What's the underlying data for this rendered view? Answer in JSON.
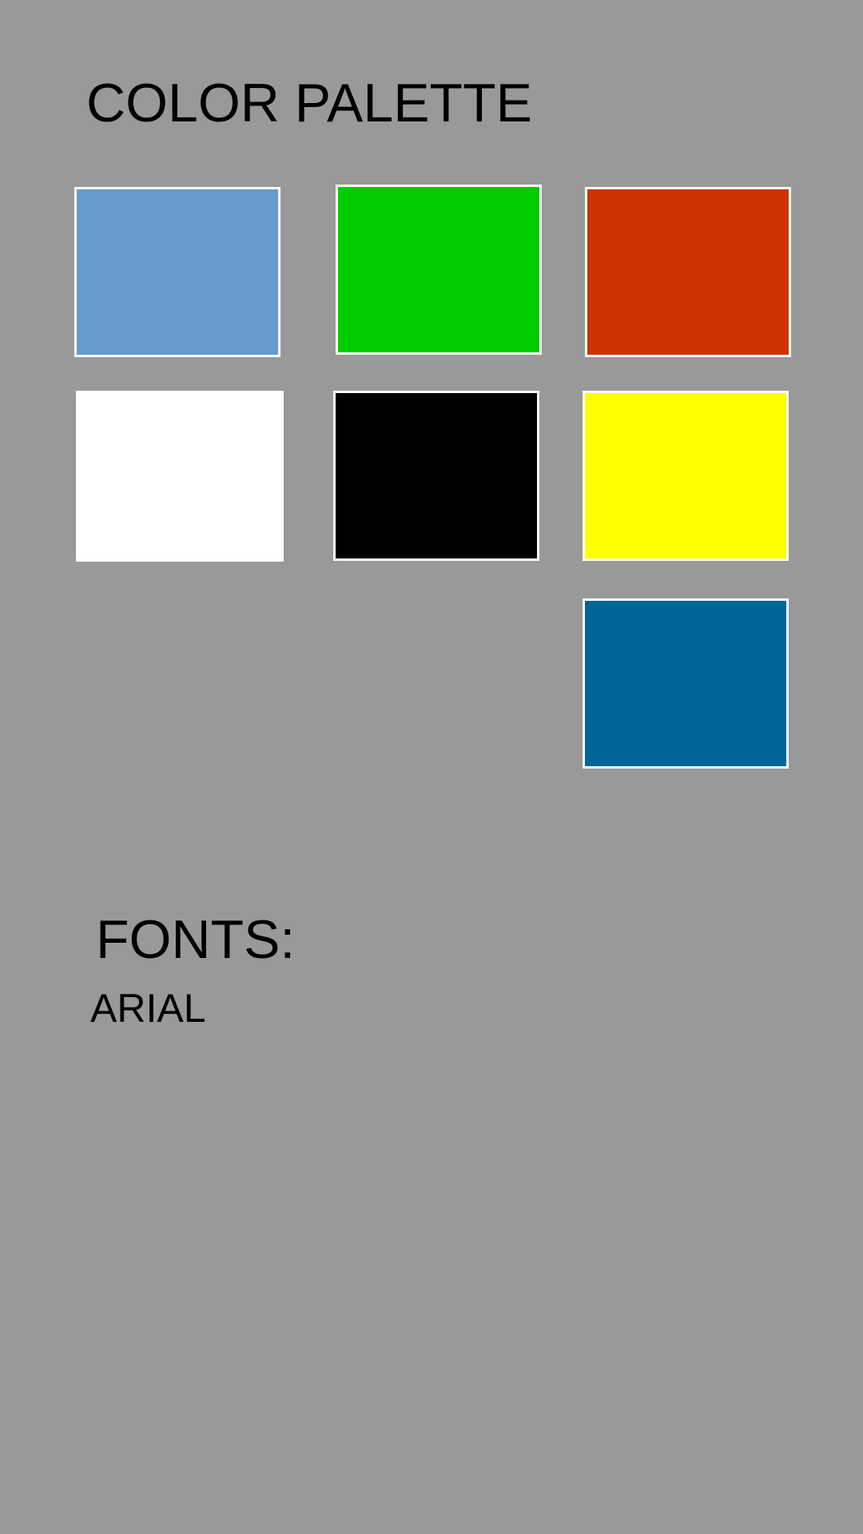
{
  "page": {
    "background": "#999999",
    "text_color": "#000000",
    "swatch_border_color": "#FFFFFF"
  },
  "title": "COLOR PALETTE",
  "palette": [
    {
      "name": "light-blue",
      "hex": "#6699CC"
    },
    {
      "name": "green",
      "hex": "#00CC00"
    },
    {
      "name": "red-orange",
      "hex": "#CC3300"
    },
    {
      "name": "white",
      "hex": "#FFFFFF"
    },
    {
      "name": "black",
      "hex": "#000000"
    },
    {
      "name": "yellow",
      "hex": "#FFFF00"
    },
    {
      "name": "dark-blue",
      "hex": "#006699"
    }
  ],
  "fonts": {
    "heading": "FONTS:",
    "items": [
      "ARIAL"
    ]
  }
}
